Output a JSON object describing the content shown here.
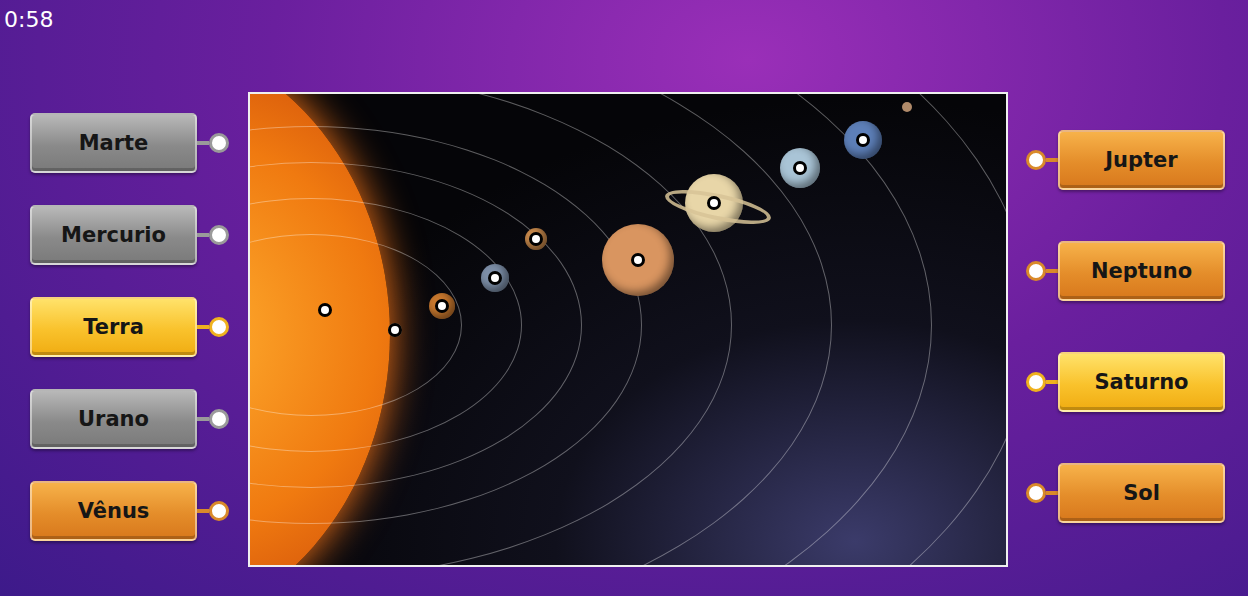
{
  "timer": "0:58",
  "left_labels": [
    {
      "label": "Marte",
      "matched": true,
      "highlighted": false
    },
    {
      "label": "Mercurio",
      "matched": true,
      "highlighted": false
    },
    {
      "label": "Terra",
      "matched": false,
      "highlighted": true
    },
    {
      "label": "Urano",
      "matched": true,
      "highlighted": false
    },
    {
      "label": "Vênus",
      "matched": false,
      "highlighted": false
    }
  ],
  "right_labels": [
    {
      "label": "Jupter",
      "matched": false,
      "highlighted": false
    },
    {
      "label": "Neptuno",
      "matched": false,
      "highlighted": false
    },
    {
      "label": "Saturno",
      "matched": false,
      "highlighted": true
    },
    {
      "label": "Sol",
      "matched": false,
      "highlighted": false
    }
  ]
}
